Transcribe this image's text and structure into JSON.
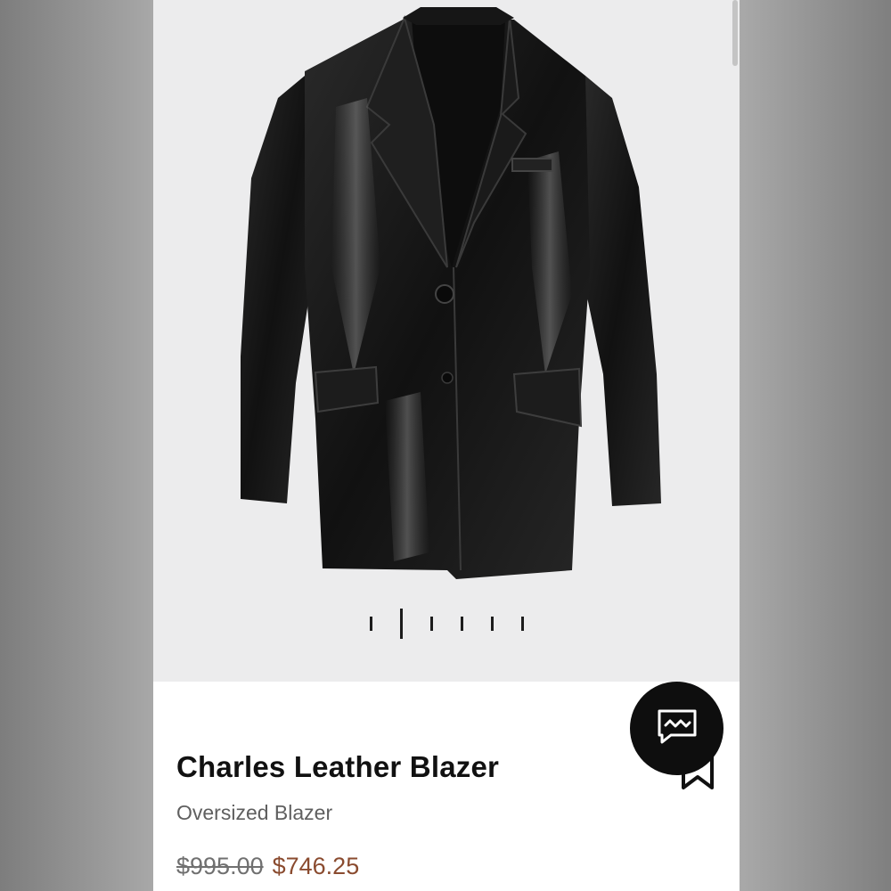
{
  "product": {
    "title": "Charles Leather Blazer",
    "subtitle": "Oversized Blazer",
    "original_price": "$995.00",
    "sale_price": "$746.25"
  },
  "gallery": {
    "image_count": 6,
    "active_index": 1,
    "image_subject": "black leather blazer"
  },
  "icons": {
    "chat": "chat-bubble-icon",
    "bookmark": "bookmark-icon"
  },
  "colors": {
    "sale_price": "#8a4b2f",
    "old_price": "#707070",
    "title": "#111111",
    "chat_button": "#0e0e0e",
    "hero_bg": "#ececed"
  }
}
